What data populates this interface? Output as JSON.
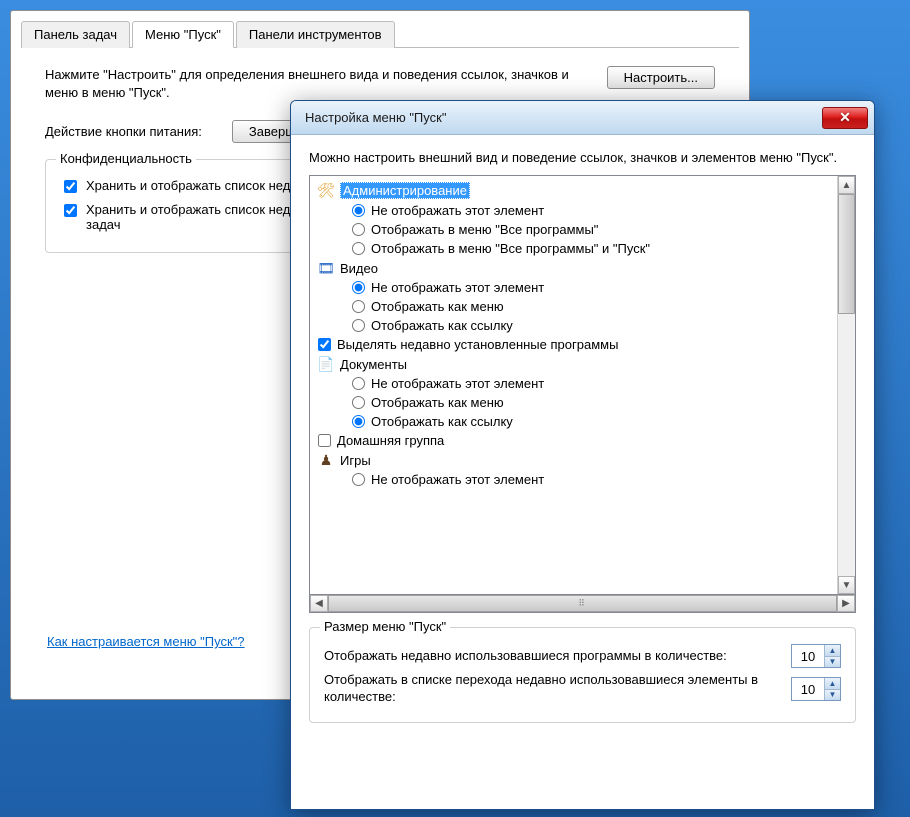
{
  "parent": {
    "tabs": [
      "Панель задач",
      "Меню \"Пуск\"",
      "Панели инструментов"
    ],
    "active_tab": 1,
    "description": "Нажмите \"Настроить\" для определения внешнего вида и поведения ссылок, значков и меню в меню \"Пуск\".",
    "customize_btn": "Настроить...",
    "power_label": "Действие кнопки питания:",
    "power_btn": "Заверш",
    "privacy_legend": "Конфиденциальность",
    "privacy_checks": [
      "Хранить и отображать список недавно использовавшихся программ в меню \"Пуск\"",
      "Хранить и отображать список недавно использовавшихся элементов в меню \"Пуск\" и на панели задач"
    ],
    "help_link": "Как настраивается меню \"Пуск\"?"
  },
  "child": {
    "title": "Настройка меню \"Пуск\"",
    "instruction": "Можно настроить внешний вид и поведение ссылок, значков и элементов меню \"Пуск\".",
    "groups": [
      {
        "label": "Администрирование",
        "icon": "admin",
        "selected": true,
        "options": [
          {
            "text": "Не отображать этот элемент",
            "checked": true
          },
          {
            "text": "Отображать в меню \"Все программы\"",
            "checked": false
          },
          {
            "text": "Отображать в меню \"Все программы\" и \"Пуск\"",
            "checked": false
          }
        ]
      },
      {
        "label": "Видео",
        "icon": "video",
        "options": [
          {
            "text": "Не отображать этот элемент",
            "checked": true
          },
          {
            "text": "Отображать как меню",
            "checked": false
          },
          {
            "text": "Отображать как ссылку",
            "checked": false
          }
        ]
      },
      {
        "label": "Выделять недавно установленные программы",
        "type": "checkbox",
        "checked": true
      },
      {
        "label": "Документы",
        "icon": "doc",
        "options": [
          {
            "text": "Не отображать этот элемент",
            "checked": false
          },
          {
            "text": "Отображать как меню",
            "checked": false
          },
          {
            "text": "Отображать как ссылку",
            "checked": true
          }
        ]
      },
      {
        "label": "Домашняя группа",
        "type": "checkbox",
        "checked": false
      },
      {
        "label": "Игры",
        "icon": "games",
        "options": [
          {
            "text": "Не отображать этот элемент",
            "checked": false
          }
        ]
      }
    ],
    "size_legend": "Размер меню \"Пуск\"",
    "size_rows": [
      {
        "label": "Отображать недавно использовавшиеся программы в количестве:",
        "value": "10"
      },
      {
        "label": "Отображать в списке перехода недавно использовавшиеся элементы в количестве:",
        "value": "10"
      }
    ]
  }
}
